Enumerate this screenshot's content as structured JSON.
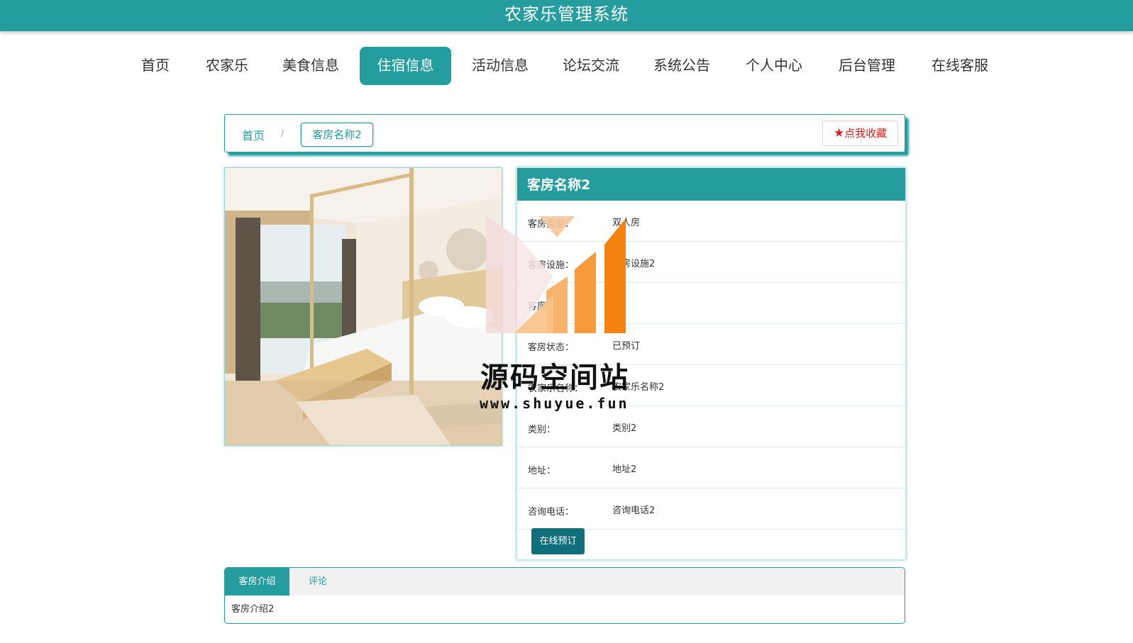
{
  "app": {
    "title": "农家乐管理系统"
  },
  "nav": {
    "items": [
      {
        "label": "首页"
      },
      {
        "label": "农家乐"
      },
      {
        "label": "美食信息"
      },
      {
        "label": "住宿信息",
        "active": true
      },
      {
        "label": "活动信息"
      },
      {
        "label": "论坛交流"
      },
      {
        "label": "系统公告"
      },
      {
        "label": "个人中心"
      },
      {
        "label": "后台管理"
      },
      {
        "label": "在线客服"
      }
    ]
  },
  "breadcrumb": {
    "home": "首页",
    "separator": "/",
    "current": "客房名称2"
  },
  "favorite": {
    "star": "★",
    "label": "点我收藏"
  },
  "room": {
    "name": "客房名称2",
    "fields": [
      {
        "label": "客房类型：",
        "value": "双人房"
      },
      {
        "label": "客房设施：",
        "value": "客房设施2"
      },
      {
        "label": "客房价格：",
        "value": ""
      },
      {
        "label": "客房状态：",
        "value": "已预订"
      },
      {
        "label": "农家乐名称：",
        "value": "农家乐名称2"
      },
      {
        "label": "类别：",
        "value": "类别2"
      },
      {
        "label": "地址：",
        "value": "地址2"
      },
      {
        "label": "咨询电话：",
        "value": "咨询电话2"
      }
    ],
    "book_label": "在线预订"
  },
  "tabs": {
    "items": [
      {
        "label": "客房介绍"
      },
      {
        "label": "评论"
      }
    ],
    "content": "客房介绍2"
  },
  "watermark": {
    "name": "源码空间站",
    "url": "www.shuyue.fun"
  },
  "colors": {
    "primary": "#259c9d",
    "book": "#0f6f7b",
    "favorite": "#e31a1a"
  }
}
